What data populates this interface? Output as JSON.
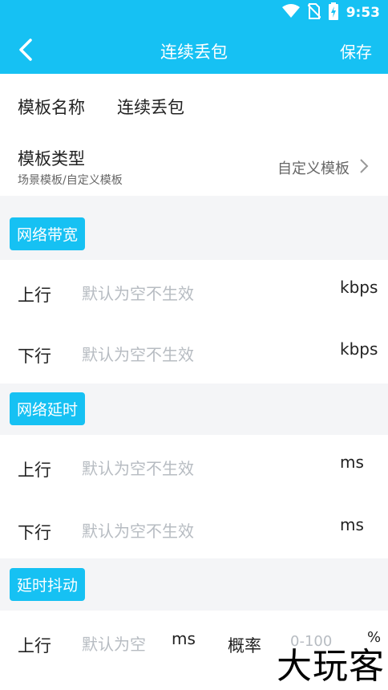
{
  "status": {
    "time": "9:53"
  },
  "appbar": {
    "title": "连续丢包",
    "save": "保存"
  },
  "template": {
    "name_label": "模板名称",
    "name_value": "连续丢包",
    "type_label": "模板类型",
    "type_sub": "场景模板/自定义模板",
    "type_value": "自定义模板"
  },
  "bandwidth": {
    "title": "网络带宽",
    "up_label": "上行",
    "down_label": "下行",
    "placeholder": "默认为空不生效",
    "unit": "kbps"
  },
  "latency": {
    "title": "网络延时",
    "up_label": "上行",
    "down_label": "下行",
    "placeholder": "默认为空不生效",
    "unit": "ms"
  },
  "jitter": {
    "title": "延时抖动",
    "up_label": "上行",
    "placeholder": "默认为空",
    "unit": "ms",
    "prob_label": "概率",
    "prob_placeholder": "0-100",
    "prob_unit": "%"
  },
  "watermark": "大玩客"
}
